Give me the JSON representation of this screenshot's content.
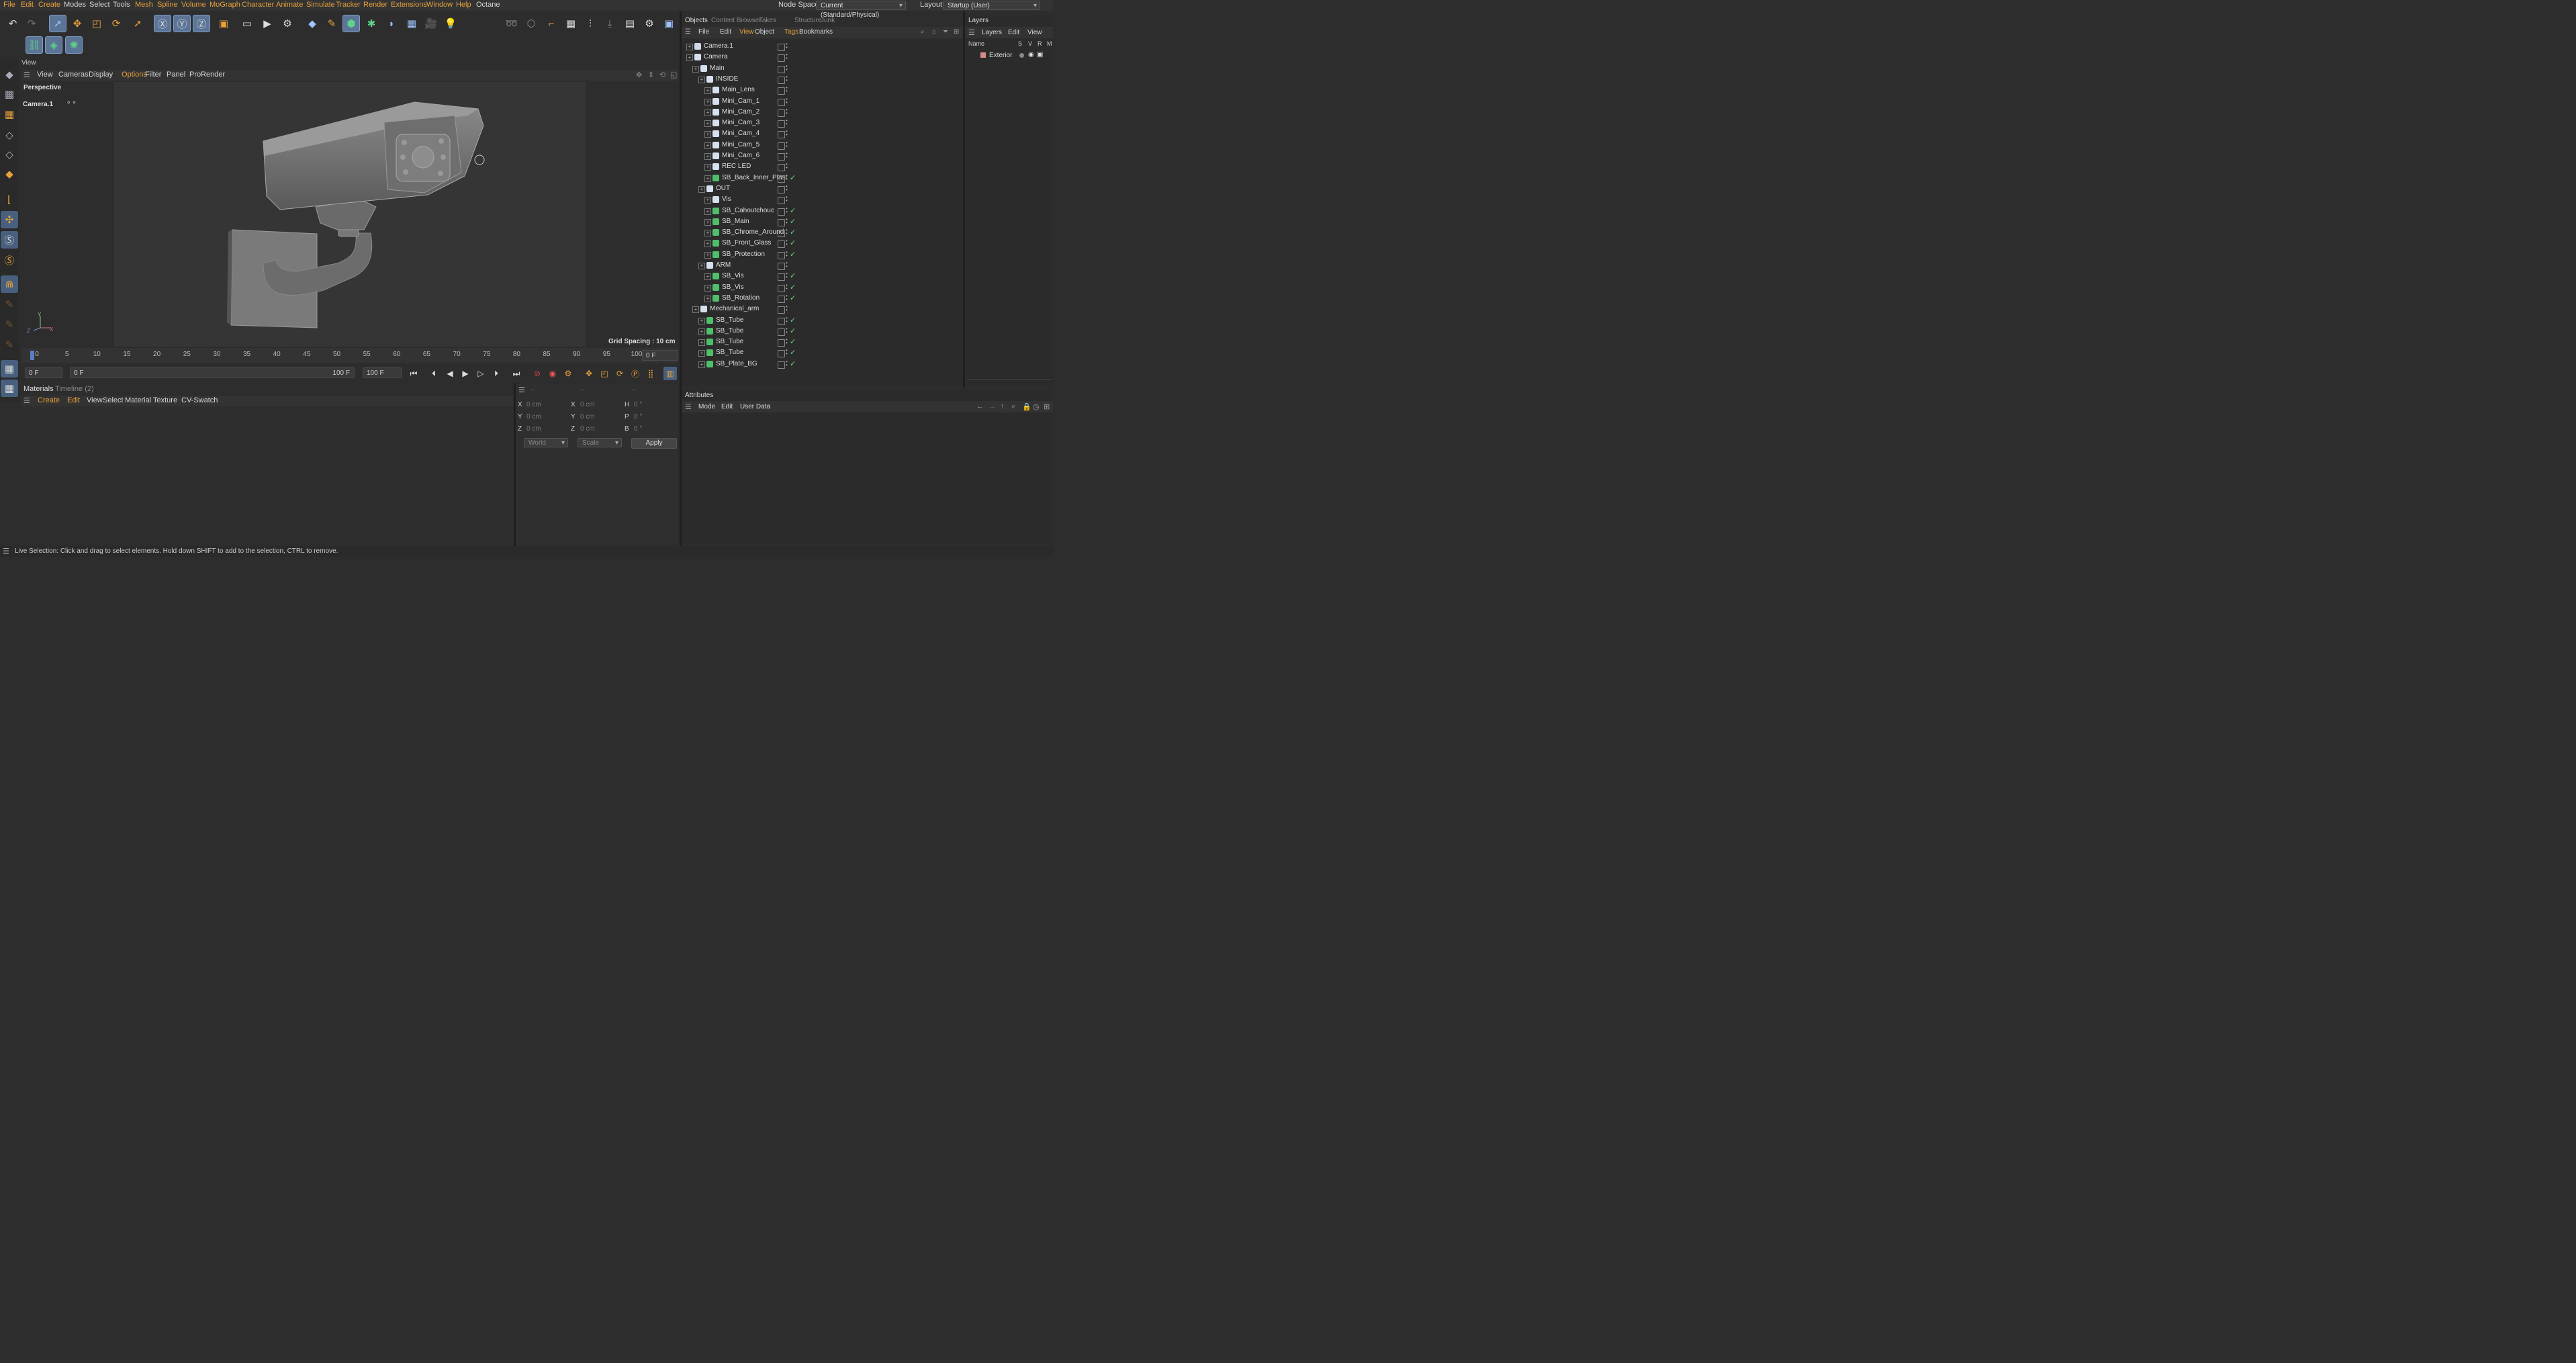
{
  "menubar": {
    "items": [
      "File",
      "Edit",
      "Create",
      "Modes",
      "Select",
      "Tools",
      "Mesh",
      "Spline",
      "Volume",
      "MoGraph",
      "Character",
      "Animate",
      "Simulate",
      "Tracker",
      "Render",
      "Extensions",
      "Window",
      "Help",
      "Octane"
    ],
    "node_space_label": "Node Space:",
    "node_space_value": "Current (Standard/Physical)",
    "layout_label": "Layout:",
    "layout_value": "Startup (User)"
  },
  "view_panel": {
    "tab": "View",
    "menu": [
      "View",
      "Cameras",
      "Display",
      "Options",
      "Filter",
      "Panel",
      "ProRender"
    ],
    "active_menu": "Options",
    "projection": "Perspective",
    "camera_name": "Camera.1",
    "grid_spacing": "Grid Spacing : 10 cm",
    "axis_labels": {
      "y": "Y",
      "x": "X",
      "z": "Z"
    }
  },
  "timeline": {
    "ticks": [
      "0",
      "5",
      "10",
      "15",
      "20",
      "25",
      "30",
      "35",
      "40",
      "45",
      "50",
      "55",
      "60",
      "65",
      "70",
      "75",
      "80",
      "85",
      "90",
      "95",
      "100"
    ],
    "current_frame_display": "0 F",
    "start_field": "0 F",
    "range_start": "0 F",
    "range_end": "100 F",
    "end_field": "100 F"
  },
  "materials": {
    "tabs": [
      "Materials",
      "Timeline (2)"
    ],
    "menu": [
      "Create",
      "Edit",
      "View",
      "Select",
      "Material",
      "Texture",
      "CV-Swatch"
    ]
  },
  "coords": {
    "header": [
      "--",
      "--",
      "--"
    ],
    "rows": [
      {
        "a": "X",
        "av": "0 cm",
        "b": "X",
        "bv": "0 cm",
        "c": "H",
        "cv": "0 °"
      },
      {
        "a": "Y",
        "av": "0 cm",
        "b": "Y",
        "bv": "0 cm",
        "c": "P",
        "cv": "0 °"
      },
      {
        "a": "Z",
        "av": "0 cm",
        "b": "Z",
        "bv": "0 cm",
        "c": "B",
        "cv": "0 °"
      }
    ],
    "space": "World",
    "mode": "Scale",
    "apply": "Apply"
  },
  "objects": {
    "tabs": [
      "Objects",
      "Content Browser",
      "Takes",
      "Structure",
      "Junk"
    ],
    "menu": [
      "File",
      "Edit",
      "View",
      "Object",
      "Tags",
      "Bookmarks"
    ],
    "rows": [
      {
        "name": "Camera.1",
        "depth": 0,
        "kind": "camera",
        "check": false
      },
      {
        "name": "Camera",
        "depth": 0,
        "kind": "null",
        "check": false
      },
      {
        "name": "Main",
        "depth": 1,
        "kind": "null",
        "check": false
      },
      {
        "name": "INSIDE",
        "depth": 2,
        "kind": "null",
        "check": false
      },
      {
        "name": "Main_Lens",
        "depth": 3,
        "kind": "null",
        "check": false
      },
      {
        "name": "Mini_Cam_1",
        "depth": 3,
        "kind": "null",
        "check": false
      },
      {
        "name": "Mini_Cam_2",
        "depth": 3,
        "kind": "null",
        "check": false
      },
      {
        "name": "Mini_Cam_3",
        "depth": 3,
        "kind": "null",
        "check": false
      },
      {
        "name": "Mini_Cam_4",
        "depth": 3,
        "kind": "null",
        "check": false
      },
      {
        "name": "Mini_Cam_5",
        "depth": 3,
        "kind": "null",
        "check": false
      },
      {
        "name": "Mini_Cam_6",
        "depth": 3,
        "kind": "null",
        "check": false
      },
      {
        "name": "REC LED",
        "depth": 3,
        "kind": "null",
        "check": false
      },
      {
        "name": "SB_Back_Inner_Plast",
        "depth": 3,
        "kind": "sub",
        "check": true
      },
      {
        "name": "OUT",
        "depth": 2,
        "kind": "null",
        "check": false
      },
      {
        "name": "Vis",
        "depth": 3,
        "kind": "null",
        "check": false
      },
      {
        "name": "SB_Cahoutchouc",
        "depth": 3,
        "kind": "sub",
        "check": true
      },
      {
        "name": "SB_Main",
        "depth": 3,
        "kind": "sub",
        "check": true
      },
      {
        "name": "SB_Chrome_Around",
        "depth": 3,
        "kind": "sub",
        "check": true
      },
      {
        "name": "SB_Front_Glass",
        "depth": 3,
        "kind": "sub",
        "check": true
      },
      {
        "name": "SB_Protection",
        "depth": 3,
        "kind": "sub",
        "check": true
      },
      {
        "name": "ARM",
        "depth": 2,
        "kind": "null",
        "check": false
      },
      {
        "name": "SB_Vis",
        "depth": 3,
        "kind": "sub",
        "check": true
      },
      {
        "name": "SB_Vis",
        "depth": 3,
        "kind": "sub",
        "check": true
      },
      {
        "name": "SB_Rotation",
        "depth": 3,
        "kind": "sub",
        "check": true
      },
      {
        "name": "Mechanical_arm",
        "depth": 1,
        "kind": "null",
        "check": false
      },
      {
        "name": "SB_Tube",
        "depth": 2,
        "kind": "sub",
        "check": true
      },
      {
        "name": "SB_Tube",
        "depth": 2,
        "kind": "sub",
        "check": true
      },
      {
        "name": "SB_Tube",
        "depth": 2,
        "kind": "sub",
        "check": true
      },
      {
        "name": "SB_Tube",
        "depth": 2,
        "kind": "sub",
        "check": true
      },
      {
        "name": "SB_Plate_BG",
        "depth": 2,
        "kind": "sub",
        "check": true
      }
    ]
  },
  "layers": {
    "tab": "Layers",
    "menu": [
      "Layers",
      "Edit",
      "View"
    ],
    "columns": [
      "Name",
      "S",
      "V",
      "R",
      "M"
    ],
    "items": [
      {
        "name": "Exterior",
        "color": "#d98b8b"
      }
    ]
  },
  "attributes": {
    "tab": "Attributes",
    "menu": [
      "Mode",
      "Edit",
      "User Data"
    ]
  },
  "status": "Live Selection: Click and drag to select elements. Hold down SHIFT to add to the selection, CTRL to remove.",
  "colors": {
    "accent": "#e8a23a",
    "active_tool": "#5c7596",
    "check": "#6fd37d"
  }
}
